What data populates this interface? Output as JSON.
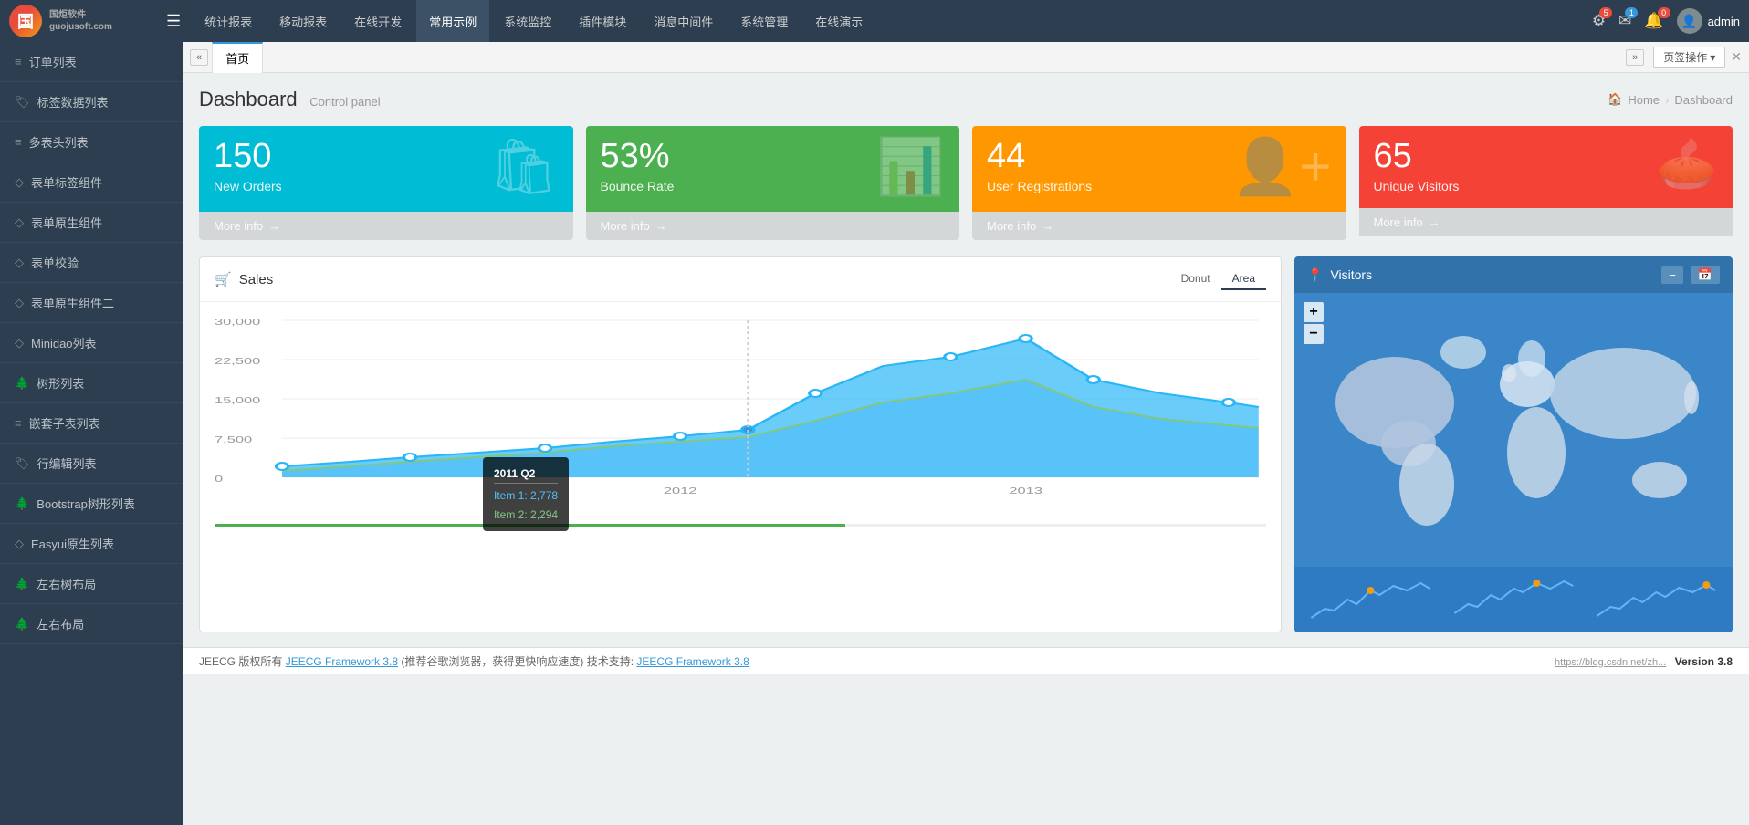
{
  "app": {
    "logo_text": "国炬软件",
    "logo_sub": "guojusoft.com"
  },
  "topnav": {
    "menu_items": [
      "统计报表",
      "移动报表",
      "在线开发",
      "常用示例",
      "系统监控",
      "插件模块",
      "消息中间件",
      "系统管理",
      "在线演示"
    ],
    "settings_badge": "5",
    "email_badge": "1",
    "bell_badge": "0",
    "username": "admin"
  },
  "tabs": {
    "back_label": "«",
    "forward_label": "»",
    "home_label": "首页",
    "tab_ops_label": "页签操作",
    "tab_ops_arrow": "▾"
  },
  "sidebar": {
    "items": [
      {
        "label": "订单列表",
        "icon": "≡"
      },
      {
        "label": "标签数据列表",
        "icon": "🏷"
      },
      {
        "label": "多表头列表",
        "icon": "≡"
      },
      {
        "label": "表单标签组件",
        "icon": "◇"
      },
      {
        "label": "表单原生组件",
        "icon": "◇"
      },
      {
        "label": "表单校验",
        "icon": "◇"
      },
      {
        "label": "表单原生组件二",
        "icon": "◇"
      },
      {
        "label": "Minidao列表",
        "icon": "◇"
      },
      {
        "label": "树形列表",
        "icon": "🌲"
      },
      {
        "label": "嵌套子表列表",
        "icon": "≡"
      },
      {
        "label": "行编辑列表",
        "icon": "🏷"
      },
      {
        "label": "Bootstrap树形列表",
        "icon": "🌲"
      },
      {
        "label": "Easyui原生列表",
        "icon": "◇"
      },
      {
        "label": "左右树布局",
        "icon": "🌲"
      },
      {
        "label": "左右布局",
        "icon": "🌲"
      }
    ]
  },
  "dashboard": {
    "title": "Dashboard",
    "subtitle": "Control panel",
    "breadcrumb_home": "Home",
    "breadcrumb_current": "Dashboard",
    "stat_cards": [
      {
        "number": "150",
        "label": "New Orders",
        "footer": "More info",
        "color": "cyan",
        "icon": "🛍"
      },
      {
        "number": "53%",
        "label": "Bounce Rate",
        "footer": "More info",
        "color": "green",
        "icon": "📊"
      },
      {
        "number": "44",
        "label": "User Registrations",
        "footer": "More info",
        "color": "orange",
        "icon": "👤"
      },
      {
        "number": "65",
        "label": "Unique Visitors",
        "footer": "More info",
        "color": "red",
        "icon": "🥧"
      }
    ],
    "sales_title": "Sales",
    "sales_tabs": [
      "Donut",
      "Area"
    ],
    "active_tab": "Area",
    "chart_y_labels": [
      "30,000",
      "22,500",
      "15,000",
      "7,500",
      "0"
    ],
    "chart_x_labels": [
      "2012",
      "2013"
    ],
    "tooltip": {
      "title": "2011 Q2",
      "item1": "Item 1: 2,778",
      "item2": "Item 2: 2,294"
    },
    "visitors_title": "Visitors"
  },
  "footer": {
    "text_prefix": "JEECG 版权所有",
    "link1_text": "JEECG Framework 3.8",
    "link1_url": "#",
    "text_middle": "(推荐谷歌浏览器，获得更快响应速度) 技术支持:",
    "link2_text": "JEECG Framework 3.8",
    "link2_url": "#",
    "version": "Version 3.8",
    "version_url": "https://blog.csdn.net/zh..."
  }
}
